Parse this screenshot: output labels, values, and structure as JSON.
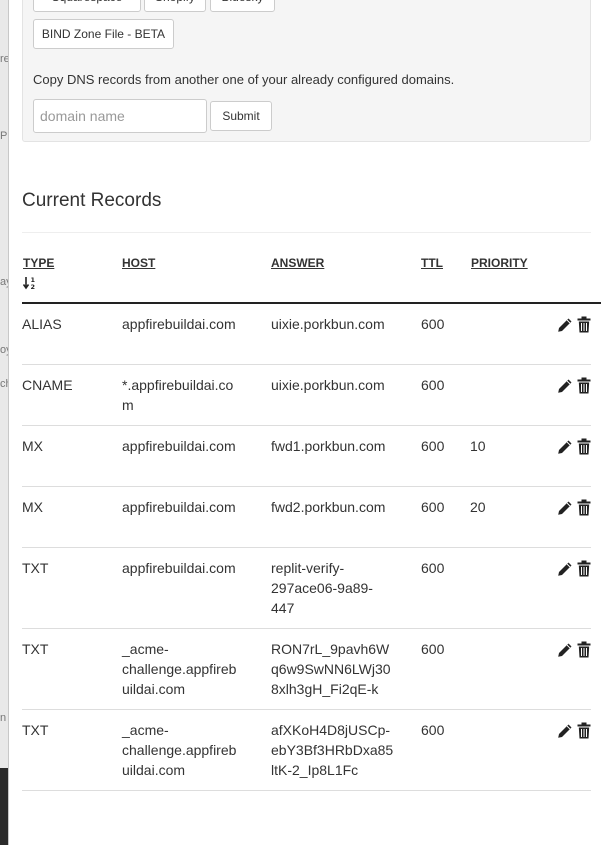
{
  "background_fragments": [
    "re",
    "P",
    "ay",
    "oy",
    "ch",
    "n"
  ],
  "import_buttons": [
    "Squarespace",
    "Shopify",
    "Bluesky",
    "BIND Zone File - BETA"
  ],
  "copy_prompt": "Copy DNS records from another one of your already configured domains.",
  "domain_input": {
    "value": "",
    "placeholder": "domain name"
  },
  "submit_label": "Submit",
  "section_title": "Current Records",
  "columns": {
    "type": "TYPE",
    "host": "HOST",
    "answer": "ANSWER",
    "ttl": "TTL",
    "priority": "PRIORITY"
  },
  "records": [
    {
      "type": "ALIAS",
      "host": "appfirebuildai.com",
      "answer": "uixie.porkbun.com",
      "ttl": "600",
      "priority": ""
    },
    {
      "type": "CNAME",
      "host": "*.appfirebuildai.com",
      "answer": "uixie.porkbun.com",
      "ttl": "600",
      "priority": ""
    },
    {
      "type": "MX",
      "host": "appfirebuildai.com",
      "answer": "fwd1.porkbun.com",
      "ttl": "600",
      "priority": "10"
    },
    {
      "type": "MX",
      "host": "appfirebuildai.com",
      "answer": "fwd2.porkbun.com",
      "ttl": "600",
      "priority": "20"
    },
    {
      "type": "TXT",
      "host": "appfirebuildai.com",
      "answer": "replit-verify-297ace06-9a89-447",
      "ttl": "600",
      "priority": ""
    },
    {
      "type": "TXT",
      "host": "_acme-challenge.appfirebuildai.com",
      "answer": "RON7rL_9pavh6Wq6w9SwNN6LWj308xlh3gH_Fi2qE-k",
      "ttl": "600",
      "priority": ""
    },
    {
      "type": "TXT",
      "host": "_acme-challenge.appfirebuildai.com",
      "answer": "afXKoH4D8jUSCp-ebY3Bf3HRbDxa85ltK-2_Ip8L1Fc",
      "ttl": "600",
      "priority": ""
    }
  ]
}
